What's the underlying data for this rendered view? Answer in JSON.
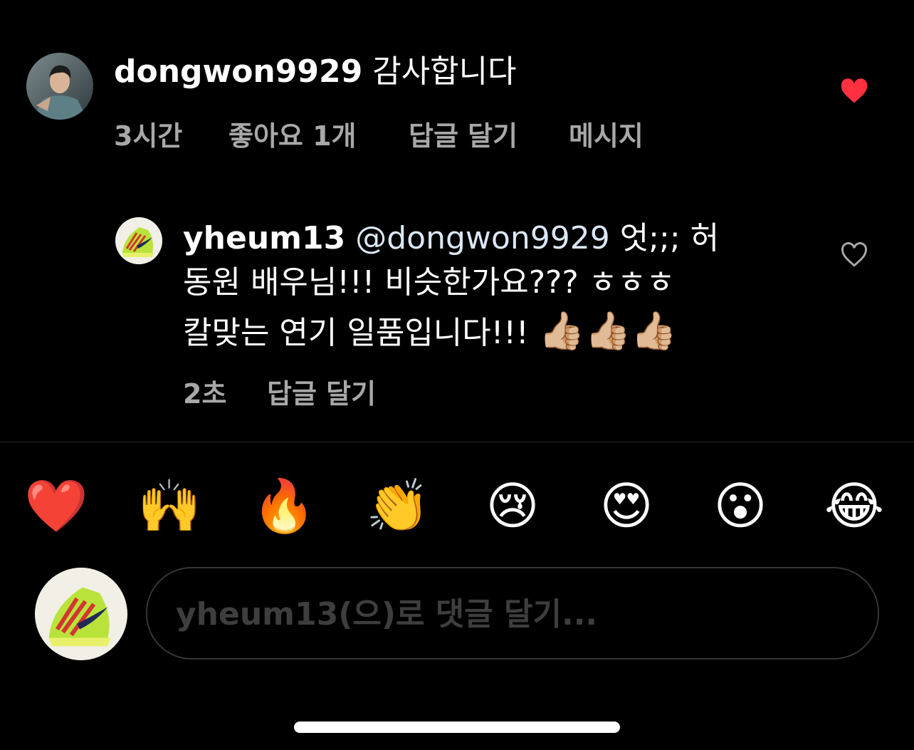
{
  "comment": {
    "username": "dongwon9929",
    "text": "감사합니다",
    "time": "3시간",
    "likes": "좋아요 1개",
    "reply_label": "답글 달기",
    "message_label": "메시지",
    "liked": true,
    "like_color": "#ff3040"
  },
  "reply": {
    "username": "yheum13",
    "mention": "@dongwon9929",
    "line1_text": "엇;;; 허",
    "line2_text": "동원 배우님!!! 비슷한가요??? ㅎㅎㅎ",
    "line3_text": "칼맞는 연기 일품입니다!!!",
    "line3_emoji": "👍🏼👍🏼👍🏼",
    "time": "2초",
    "reply_label": "답글 달기",
    "liked": false
  },
  "reactions": [
    "❤️",
    "🙌",
    "🔥",
    "👏",
    "😢",
    "😍",
    "😮",
    "😂"
  ],
  "composer": {
    "placeholder": "yheum13(으)로 댓글 달기...",
    "value": ""
  },
  "colors": {
    "background": "#000000",
    "meta_text": "#a8a8a8",
    "mention": "#dbe7f5",
    "input_border": "#363636",
    "placeholder": "#3e3e3e"
  }
}
